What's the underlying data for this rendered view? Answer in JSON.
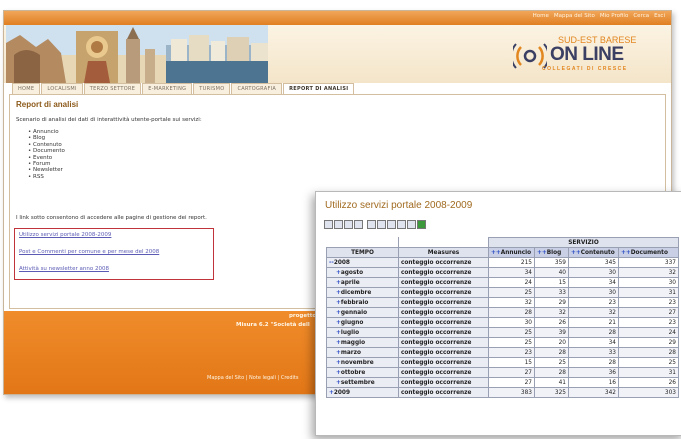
{
  "portal": {
    "top_links": [
      "Home",
      "Mappa del Sito",
      "Mio Profilo",
      "Cerca",
      "Esci"
    ],
    "logo": {
      "sub": "SUD-EST BARESE",
      "main": "ON LINE",
      "tag": "COLLEGATI DI CRESCE"
    },
    "tabs": [
      "HOME",
      "LOCALISMI",
      "TERZO SETTORE",
      "E-MARKETING",
      "TURISMO",
      "CARTOGRAFIA",
      "REPORT DI ANALISI"
    ],
    "active_tab": "REPORT DI ANALISI",
    "report_title": "Report di analisi",
    "intro": "Scenario di analisi dei dati di interattività utente-portale sui servizi:",
    "services": [
      "Annuncio",
      "Blog",
      "Contenuto",
      "Documento",
      "Evento",
      "Forum",
      "Newsletter",
      "RSS"
    ],
    "links_intro": "I link sotto consentono di accedere alle pagine di gestione dei report.",
    "links": [
      "Utilizzo servizi portale 2008-2009",
      "Post e Commenti per comune e per mese del 2008",
      "Attività su newsletter anno 2008"
    ],
    "footer": {
      "line1": "progetto",
      "line2": "Misura 6.2 \"Società dell",
      "links": "Mappa del Sito | Note legali | Credits"
    }
  },
  "olap": {
    "title": "Utilizzo servizi portale 2008-2009",
    "toolbar_icons": [
      "cube-icon",
      "navigator-icon",
      "table-icon",
      "swap-axes-icon",
      "drill-icon",
      "chart-icon",
      "config-chart-icon",
      "print-icon",
      "print-settings-icon",
      "excel-icon"
    ],
    "dimension_header": "SERVIZIO",
    "col_headers": {
      "tempo": "TEMPO",
      "measures": "Measures"
    },
    "services": [
      "Annuncio",
      "Blog",
      "Contenuto",
      "Documento"
    ],
    "rows": [
      {
        "label": "2008",
        "toggle": "--",
        "level": 0,
        "measure": "conteggio occorrenze",
        "values": [
          "215",
          "359",
          "345",
          "337"
        ]
      },
      {
        "label": "agosto",
        "toggle": "+",
        "level": 1,
        "measure": "conteggio occorrenze",
        "values": [
          "34",
          "40",
          "30",
          "32"
        ]
      },
      {
        "label": "aprile",
        "toggle": "+",
        "level": 1,
        "measure": "conteggio occorrenze",
        "values": [
          "24",
          "15",
          "34",
          "30"
        ]
      },
      {
        "label": "dicembre",
        "toggle": "+",
        "level": 1,
        "measure": "conteggio occorrenze",
        "values": [
          "25",
          "33",
          "30",
          "31"
        ]
      },
      {
        "label": "febbraio",
        "toggle": "+",
        "level": 1,
        "measure": "conteggio occorrenze",
        "values": [
          "32",
          "29",
          "23",
          "23"
        ]
      },
      {
        "label": "gennaio",
        "toggle": "+",
        "level": 1,
        "measure": "conteggio occorrenze",
        "values": [
          "28",
          "32",
          "32",
          "27"
        ]
      },
      {
        "label": "giugno",
        "toggle": "+",
        "level": 1,
        "measure": "conteggio occorrenze",
        "values": [
          "30",
          "26",
          "21",
          "23"
        ]
      },
      {
        "label": "luglio",
        "toggle": "+",
        "level": 1,
        "measure": "conteggio occorrenze",
        "values": [
          "25",
          "39",
          "28",
          "24"
        ]
      },
      {
        "label": "maggio",
        "toggle": "+",
        "level": 1,
        "measure": "conteggio occorrenze",
        "values": [
          "25",
          "20",
          "34",
          "29"
        ]
      },
      {
        "label": "marzo",
        "toggle": "+",
        "level": 1,
        "measure": "conteggio occorrenze",
        "values": [
          "23",
          "28",
          "33",
          "28"
        ]
      },
      {
        "label": "novembre",
        "toggle": "+",
        "level": 1,
        "measure": "conteggio occorrenze",
        "values": [
          "15",
          "25",
          "28",
          "25"
        ]
      },
      {
        "label": "ottobre",
        "toggle": "+",
        "level": 1,
        "measure": "conteggio occorrenze",
        "values": [
          "27",
          "28",
          "36",
          "31"
        ]
      },
      {
        "label": "settembre",
        "toggle": "+",
        "level": 1,
        "measure": "conteggio occorrenze",
        "values": [
          "27",
          "41",
          "16",
          "26"
        ]
      },
      {
        "label": "2009",
        "toggle": "+",
        "level": 0,
        "measure": "conteggio occorrenze",
        "values": [
          "383",
          "325",
          "342",
          "303"
        ]
      }
    ]
  },
  "colors": {
    "orange": "#e2861f",
    "link_box": "#c0333b",
    "link": "#5b5bb5",
    "olap_title": "#a06a1f"
  }
}
